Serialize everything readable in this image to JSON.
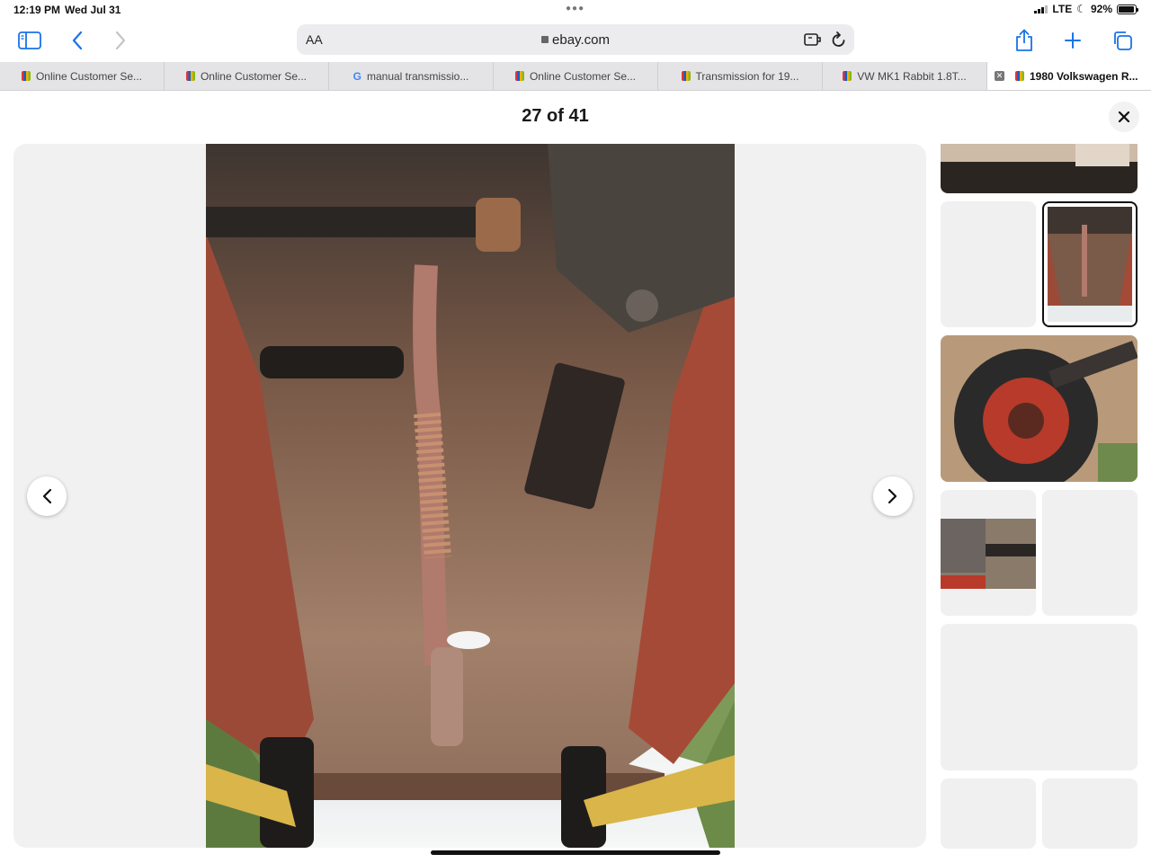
{
  "status": {
    "time": "12:19 PM",
    "date": "Wed Jul 31",
    "network": "LTE",
    "battery": "92%",
    "battery_level": 0.92
  },
  "toolbar": {
    "text_size_label": "AA",
    "url": "ebay.com"
  },
  "tabs": [
    {
      "label": "Online Customer Se...",
      "favicon": "ebay"
    },
    {
      "label": "Online Customer Se...",
      "favicon": "ebay"
    },
    {
      "label": "manual transmissio...",
      "favicon": "google"
    },
    {
      "label": "Online Customer Se...",
      "favicon": "ebay"
    },
    {
      "label": "Transmission for 19...",
      "favicon": "ebay"
    },
    {
      "label": "VW MK1 Rabbit 1.8T...",
      "favicon": "ebay"
    },
    {
      "label": "1980 Volkswagen R...",
      "favicon": "ebay",
      "active": true
    }
  ],
  "viewer": {
    "counter": "27 of 41"
  },
  "icons": [
    "sidebar-icon",
    "back-icon",
    "forward-icon",
    "lock-icon",
    "extension-icon",
    "reload-icon",
    "share-icon",
    "new-tab-icon",
    "tabs-overview-icon",
    "close-icon",
    "chevron-left-icon",
    "chevron-right-icon"
  ],
  "colors": {
    "accent": "#1a73e8",
    "stage_bg": "#f1f1f2",
    "car_red": "#b83a2a"
  }
}
